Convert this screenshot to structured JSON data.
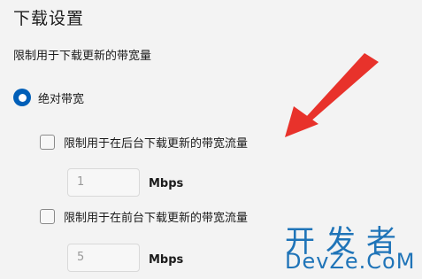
{
  "section": {
    "title": "下载设置",
    "description": "限制用于下载更新的带宽量"
  },
  "radio": {
    "label": "绝对带宽",
    "checked": true
  },
  "options": [
    {
      "label": "限制用于在后台下载更新的带宽流量",
      "checked": false,
      "value": "1",
      "unit": "Mbps"
    },
    {
      "label": "限制用于在前台下载更新的带宽流量",
      "checked": false,
      "value": "5",
      "unit": "Mbps"
    }
  ],
  "watermark": {
    "top": "开发者",
    "bottom": "DevZe.CoM"
  },
  "colors": {
    "accent": "#005fb8",
    "arrow": "#e8322b",
    "watermark": "#1f74b8"
  }
}
